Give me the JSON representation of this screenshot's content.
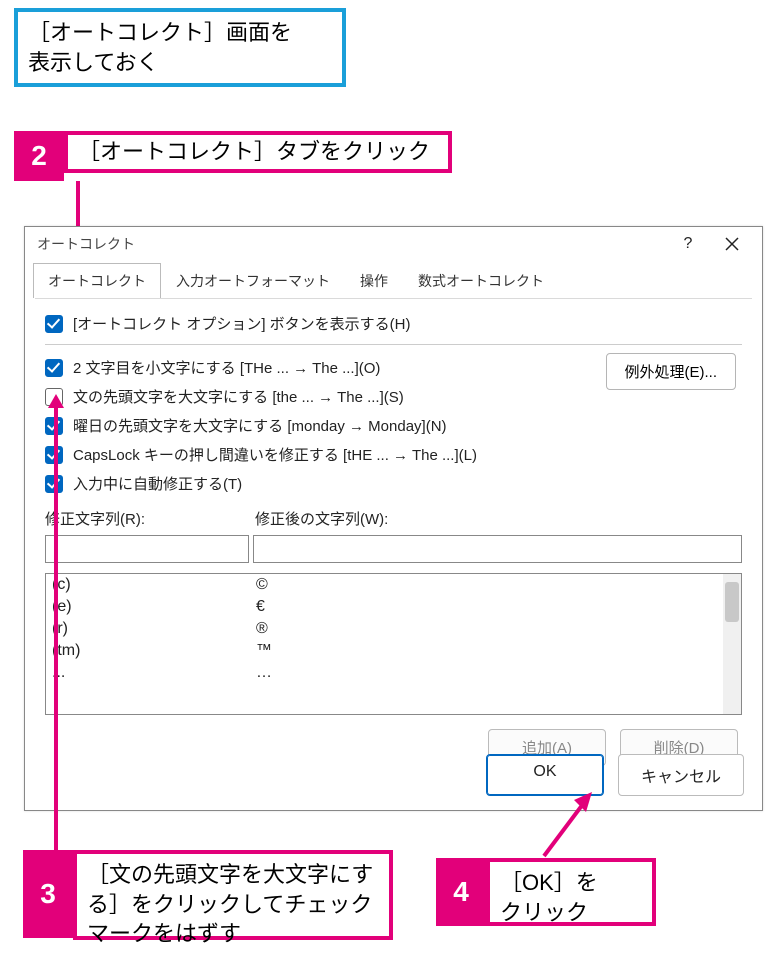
{
  "callouts": {
    "blue": "［オートコレクト］画面を\n表示しておく",
    "step2": {
      "num": "2",
      "text": "［オートコレクト］タブをクリック"
    },
    "step3": {
      "num": "3",
      "text": "［文の先頭文字を大文字にする］をクリックしてチェックマークをはずす"
    },
    "step4": {
      "num": "4",
      "text": "［OK］を\nクリック"
    }
  },
  "dialog": {
    "title": "オートコレクト",
    "help_icon": "?",
    "tabs": {
      "autocorrect": "オートコレクト",
      "autoformat": "入力オートフォーマット",
      "actions": "操作",
      "math": "数式オートコレクト"
    },
    "options": {
      "show_button": "[オートコレクト オプション] ボタンを表示する(H)",
      "second_char": "2 文字目を小文字にする [THe ... → The ...](O)",
      "sentence_cap": "文の先頭文字を大文字にする [the ... → The ...](S)",
      "weekday_cap": "曜日の先頭文字を大文字にする [monday → Monday](N)",
      "capslock": "CapsLock キーの押し間違いを修正する [tHE ... → The ...](L)",
      "replace_as_type": "入力中に自動修正する(T)"
    },
    "exceptions_btn": "例外処理(E)...",
    "replace": {
      "label_replace": "修正文字列(R):",
      "label_with": "修正後の文字列(W):"
    },
    "list": [
      {
        "from": "(c)",
        "to": "©"
      },
      {
        "from": "(e)",
        "to": "€"
      },
      {
        "from": "(r)",
        "to": "®"
      },
      {
        "from": "(tm)",
        "to": "™"
      },
      {
        "from": "...",
        "to": "…"
      }
    ],
    "buttons": {
      "add": "追加(A)",
      "delete": "削除(D)",
      "ok": "OK",
      "cancel": "キャンセル"
    }
  }
}
